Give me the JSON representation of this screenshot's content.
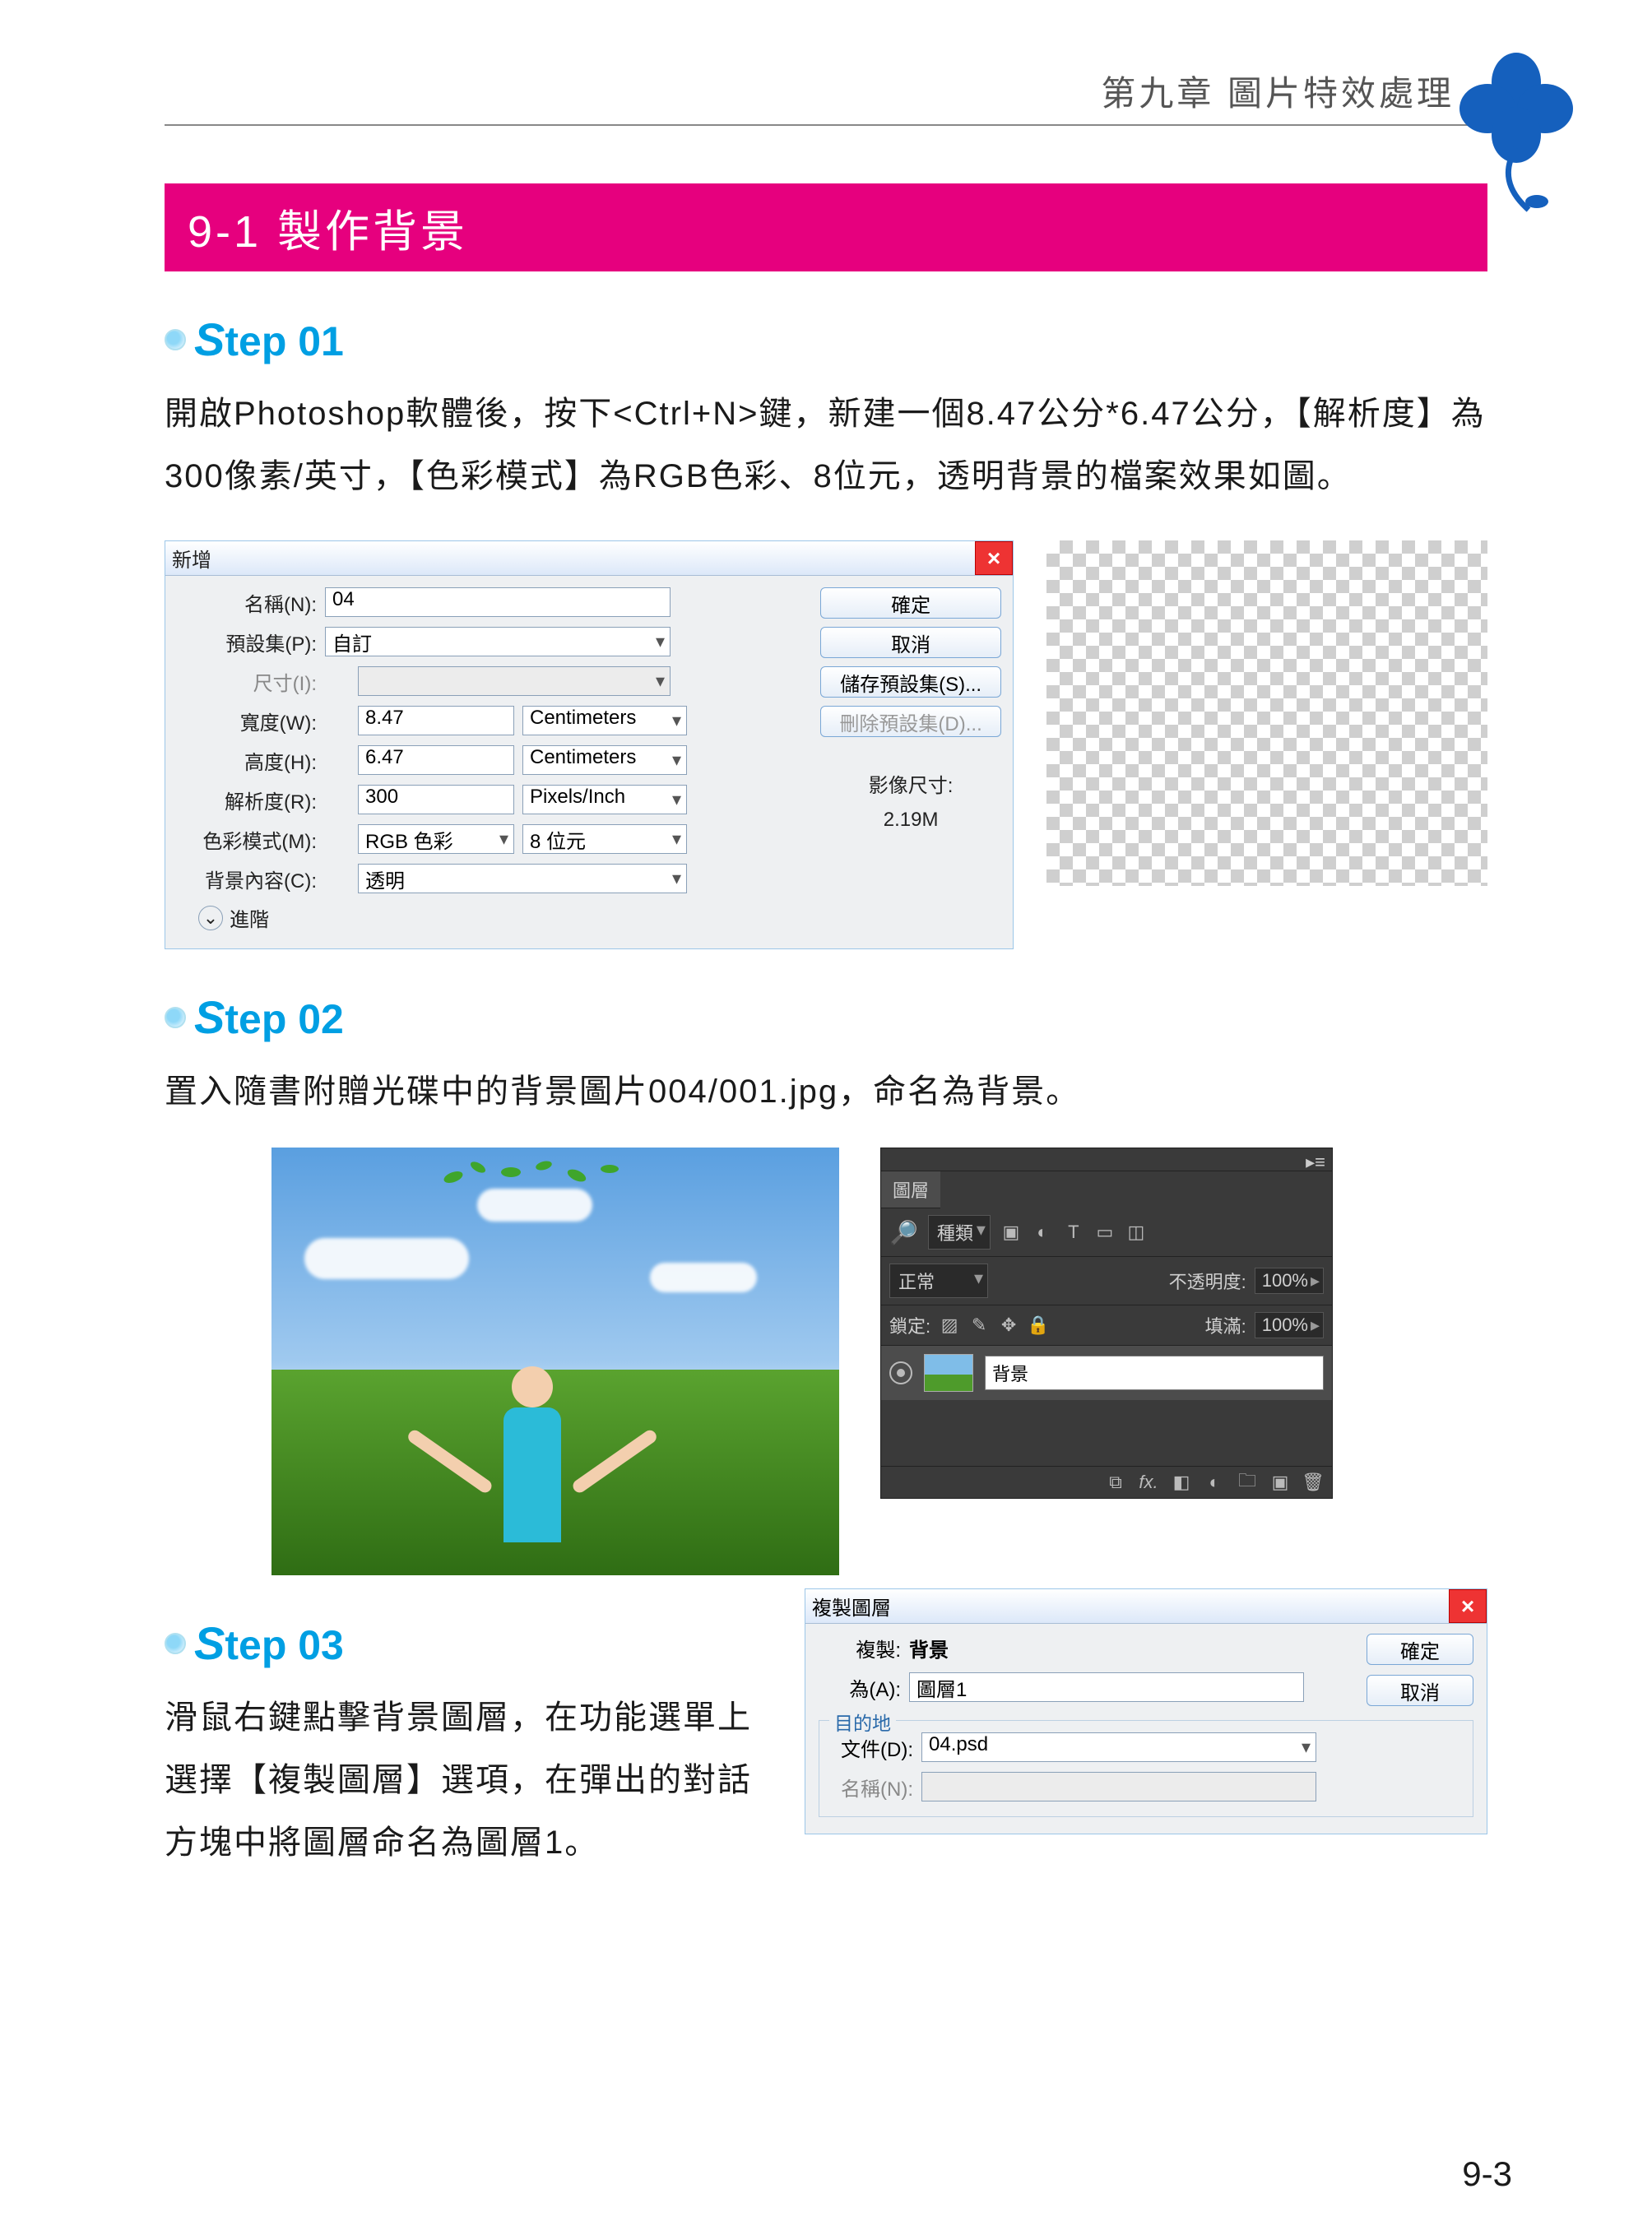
{
  "chapter": "第九章 圖片特效處理",
  "section_title": "9-1 製作背景",
  "page_number": "9-3",
  "step01": {
    "heading_prefix": "S",
    "heading_rest": "tep 01",
    "paragraph": "開啟Photoshop軟體後，按下<Ctrl+N>鍵，新建一個8.47公分*6.47公分，【解析度】為300像素/英寸，【色彩模式】為RGB色彩、8位元，透明背景的檔案效果如圖。",
    "dialog": {
      "title": "新增",
      "name_label": "名稱(N):",
      "name_value": "04",
      "preset_label": "預設集(P):",
      "preset_value": "自訂",
      "size_label": "尺寸(I):",
      "width_label": "寬度(W):",
      "width_value": "8.47",
      "width_unit": "Centimeters",
      "height_label": "高度(H):",
      "height_value": "6.47",
      "height_unit": "Centimeters",
      "res_label": "解析度(R):",
      "res_value": "300",
      "res_unit": "Pixels/Inch",
      "mode_label": "色彩模式(M):",
      "mode_value": "RGB 色彩",
      "mode_bits": "8 位元",
      "bgcontent_label": "背景內容(C):",
      "bgcontent_value": "透明",
      "advanced_label": "進階",
      "imagesize_label": "影像尺寸:",
      "imagesize_value": "2.19M",
      "btn_ok": "確定",
      "btn_cancel": "取消",
      "btn_savepreset": "儲存預設集(S)...",
      "btn_delpreset": "刪除預設集(D)..."
    }
  },
  "step02": {
    "heading_prefix": "S",
    "heading_rest": "tep 02",
    "paragraph": "置入隨書附贈光碟中的背景圖片004/001.jpg，命名為背景。",
    "layers_panel": {
      "tab": "圖層",
      "kind_label": "種類",
      "blend_mode": "正常",
      "opacity_label": "不透明度:",
      "opacity_value": "100%",
      "lock_label": "鎖定:",
      "fill_label": "填滿:",
      "fill_value": "100%",
      "layer_name": "背景"
    }
  },
  "step03": {
    "heading_prefix": "S",
    "heading_rest": "tep 03",
    "paragraph": "滑鼠右鍵點擊背景圖層，在功能選單上選擇【複製圖層】選項，在彈出的對話方塊中將圖層命名為圖層1。",
    "dialog": {
      "title": "複製圖層",
      "dup_label": "複製:",
      "dup_value": "背景",
      "as_label": "為(A):",
      "as_value": "圖層1",
      "fieldset": "目的地",
      "doc_label": "文件(D):",
      "doc_value": "04.psd",
      "name_label": "名稱(N):",
      "btn_ok": "確定",
      "btn_cancel": "取消"
    }
  }
}
